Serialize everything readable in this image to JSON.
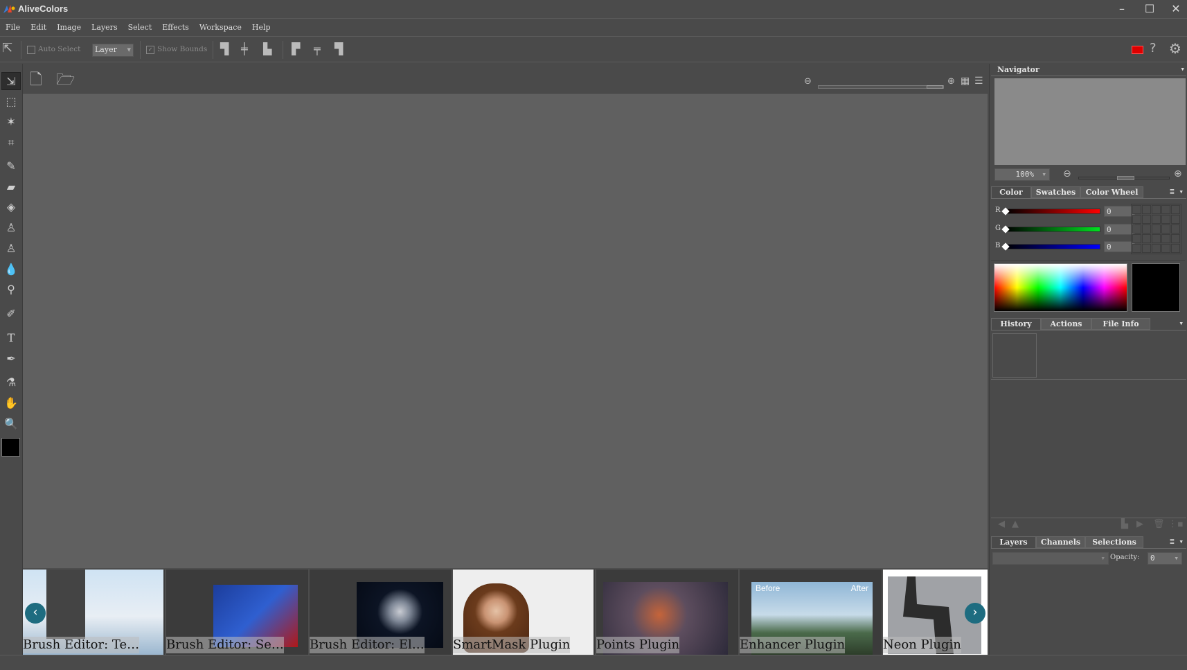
{
  "app": {
    "title": "AliveColors"
  },
  "window": {
    "minimize": "–",
    "maximize": "☐",
    "close": "✕"
  },
  "menu": [
    "File",
    "Edit",
    "Image",
    "Layers",
    "Select",
    "Effects",
    "Workspace",
    "Help"
  ],
  "options": {
    "auto_select": "Auto Select",
    "auto_select_checked": false,
    "target": "Layer",
    "show_bounds": "Show Bounds",
    "show_bounds_checked": true
  },
  "navigator": {
    "title": "Navigator",
    "zoom": "100%"
  },
  "color": {
    "tabs": [
      "Color",
      "Swatches",
      "Color Wheel"
    ],
    "channels": [
      {
        "label": "R",
        "value": "0",
        "color": "#ff0000"
      },
      {
        "label": "G",
        "value": "0",
        "color": "#00e020"
      },
      {
        "label": "B",
        "value": "0",
        "color": "#0000ff"
      }
    ],
    "current": "#000000"
  },
  "history": {
    "tabs": [
      "History",
      "Actions",
      "File Info"
    ]
  },
  "layers": {
    "tabs": [
      "Layers",
      "Channels",
      "Selections"
    ],
    "opacity_label": "Opacity:",
    "opacity": "0"
  },
  "filmstrip": [
    {
      "caption": "Brush Editor: Te…"
    },
    {
      "caption": "Brush Editor: Se…"
    },
    {
      "caption": "Brush Editor: El…"
    },
    {
      "caption": "SmartMask Plugin"
    },
    {
      "caption": "Points Plugin"
    },
    {
      "caption": "Enhancer Plugin"
    },
    {
      "caption": "Neon Plugin"
    }
  ],
  "thumb_text": {
    "before": "Before",
    "after": "After"
  }
}
